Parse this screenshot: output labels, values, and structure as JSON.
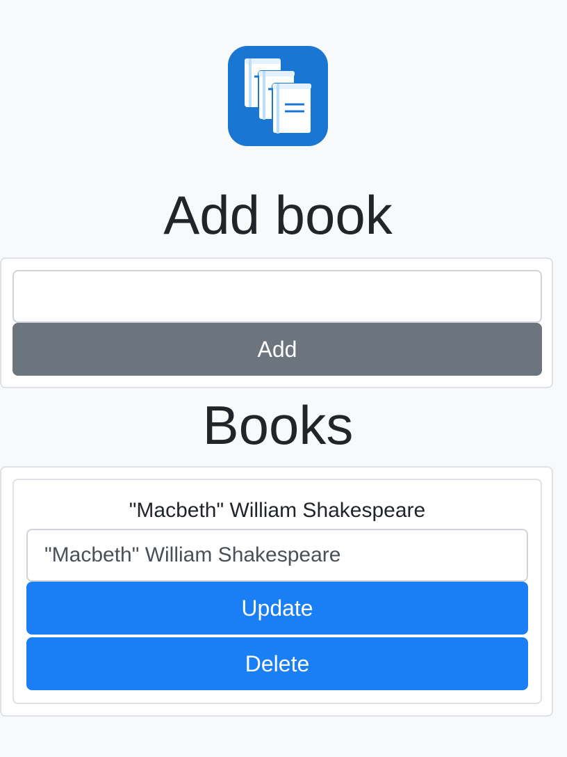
{
  "app": {
    "logo_icon": "books-stack-icon",
    "logo_color": "#1976d2"
  },
  "add_section": {
    "heading": "Add book",
    "input_value": "",
    "input_placeholder": "",
    "add_button_label": "Add",
    "add_button_color": "#6c757d"
  },
  "books_section": {
    "heading": "Books",
    "items": [
      {
        "title": "\"Macbeth\" William Shakespeare",
        "edit_value": "\"Macbeth\" William Shakespeare",
        "update_label": "Update",
        "delete_label": "Delete"
      }
    ],
    "button_color": "#1a7ff5"
  }
}
